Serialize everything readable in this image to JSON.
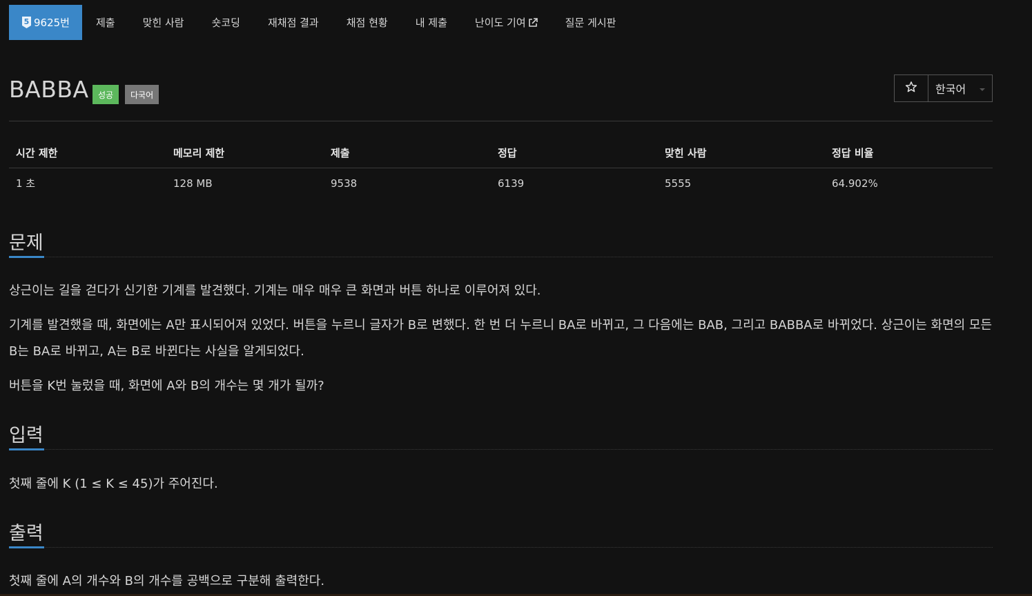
{
  "menu": {
    "tier_number": "5",
    "problem_id": "9625번",
    "submit": "제출",
    "solved_users": "맞힌 사람",
    "shortest_code": "숏코딩",
    "rejudge_result": "재채점 결과",
    "rejudge_status": "채점 현황",
    "my_submissions": "내 제출",
    "difficulty_contribute": "난이도 기여",
    "question_board": "질문 게시판"
  },
  "problem": {
    "title": "BABBA",
    "label_success": "성공",
    "label_multilang": "다국어",
    "language_button": "한국어"
  },
  "info": {
    "headers": [
      "시간 제한",
      "메모리 제한",
      "제출",
      "정답",
      "맞힌 사람",
      "정답 비율"
    ],
    "values": [
      "1 초",
      "128 MB",
      "9538",
      "6139",
      "5555",
      "64.902%"
    ]
  },
  "sections": {
    "description": {
      "heading": "문제",
      "paragraphs": [
        "상근이는 길을 걷다가 신기한 기계를 발견했다. 기계는 매우 매우 큰 화면과 버튼 하나로 이루어져 있다.",
        "기계를 발견했을 때, 화면에는 A만 표시되어져 있었다. 버튼을 누르니 글자가 B로 변했다. 한 번 더 누르니 BA로 바뀌고, 그 다음에는 BAB, 그리고 BABBA로 바뀌었다. 상근이는 화면의 모든 B는 BA로 바뀌고, A는 B로 바뀐다는 사실을 알게되었다.",
        "버튼을 K번 눌렀을 때, 화면에 A와 B의 개수는 몇 개가 될까?"
      ]
    },
    "input": {
      "heading": "입력",
      "text": "첫째 줄에 K (1 ≤ K ≤ 45)가 주어진다."
    },
    "output": {
      "heading": "출력",
      "text": "첫째 줄에 A의 개수와 B의 개수를 공백으로 구분해 출력한다."
    }
  },
  "colors": {
    "accent": "#3a87c8",
    "success": "#5cb85c",
    "multilang": "#777777",
    "background": "#121212"
  },
  "icons": {
    "tier": "tier-badge-icon",
    "external": "external-link-icon",
    "star": "star-outline-icon",
    "caret": "caret-down-icon"
  }
}
